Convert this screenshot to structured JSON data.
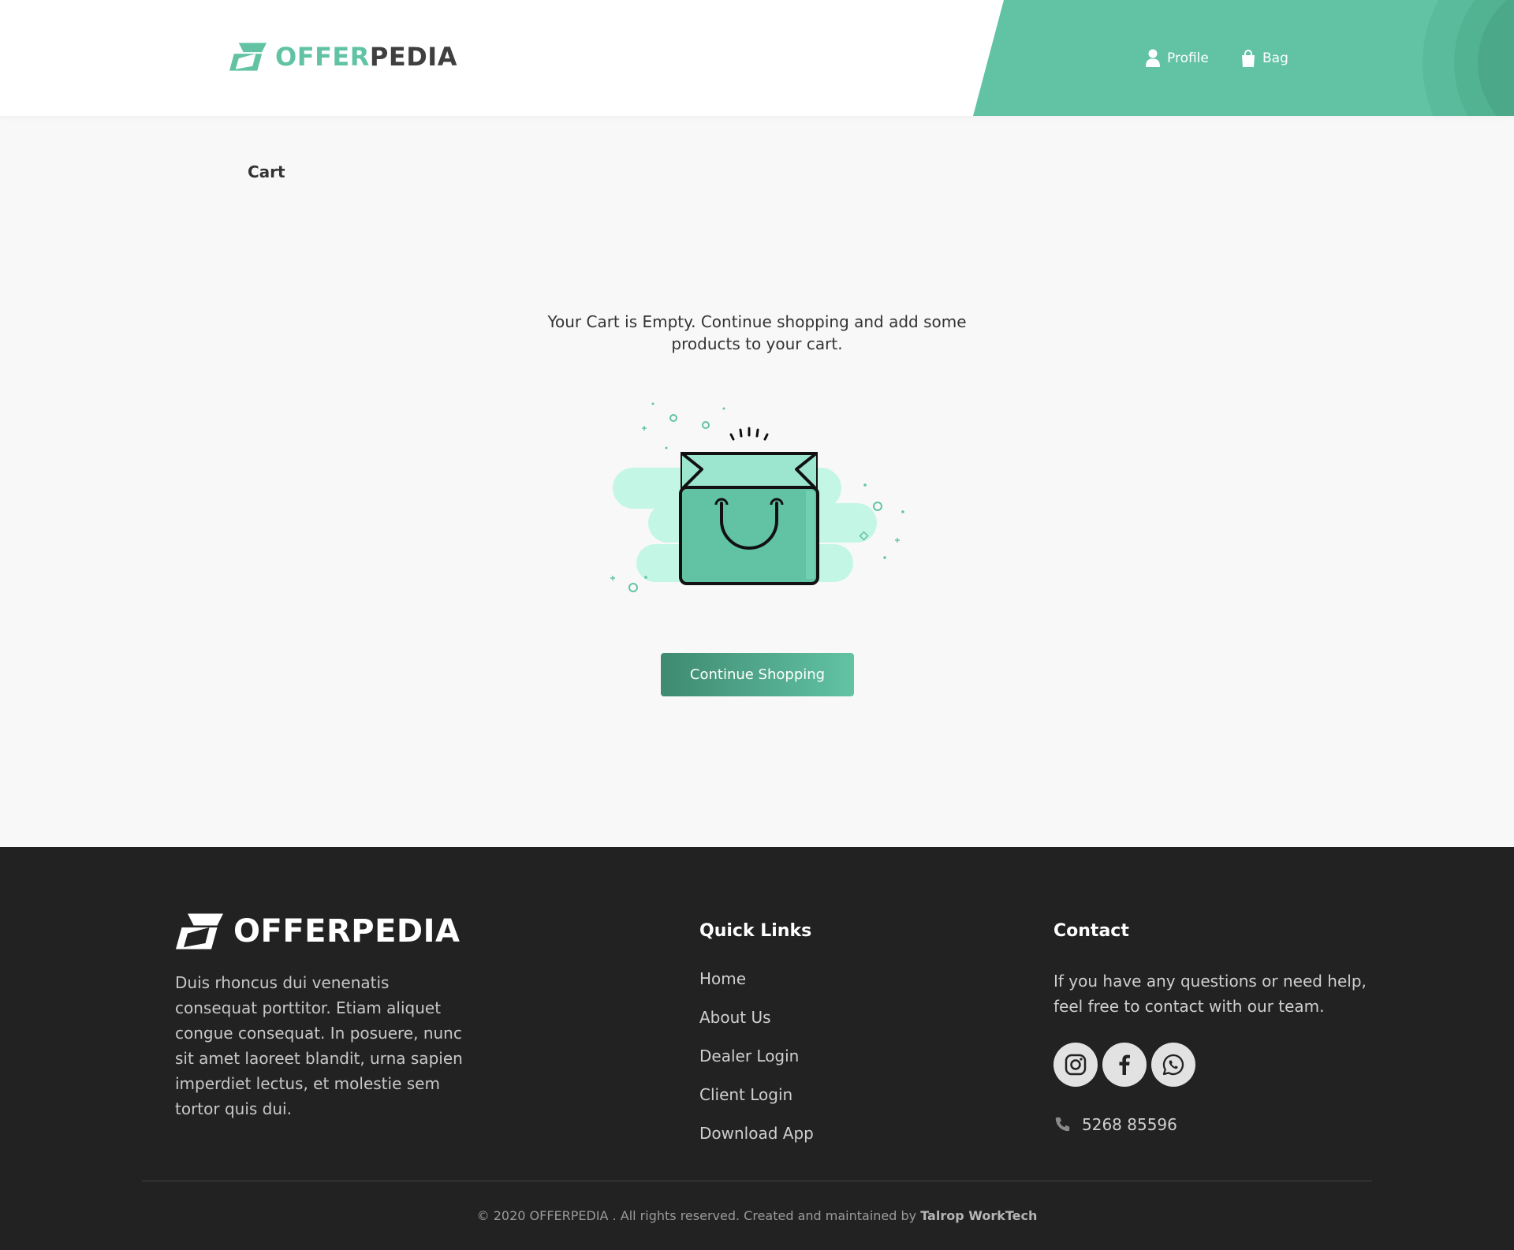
{
  "header": {
    "logo_part1": "OFFER",
    "logo_part2": "PEDIA",
    "nav": {
      "profile": "Profile",
      "bag": "Bag"
    }
  },
  "main": {
    "breadcrumb": "Cart",
    "empty_message": "Your Cart is Empty. Continue shopping and add some products to your cart.",
    "illustration_icon": "shopping-bag-smile-icon",
    "button_label": "Continue Shopping"
  },
  "footer": {
    "logo_text": "OFFERPEDIA",
    "about": "Duis rhoncus dui venenatis consequat porttitor. Etiam aliquet congue consequat. In posuere, nunc sit amet laoreet blandit, urna sapien imperdiet lectus, et molestie sem tortor quis dui.",
    "quick_links_title": "Quick Links",
    "links": [
      "Home",
      "About Us",
      "Dealer Login",
      "Client Login",
      "Download App"
    ],
    "contact_title": "Contact",
    "contact_text": "If you have any questions or need help, feel free to contact with our team.",
    "socials": [
      "instagram-icon",
      "facebook-icon",
      "whatsapp-icon"
    ],
    "phone": "5268 85596",
    "copyright_prefix": "© 2020 OFFERPEDIA . All rights reserved. Created and maintained by ",
    "copyright_company": "Talrop WorkTech"
  },
  "colors": {
    "accent": "#62c3a4",
    "accent_dark": "#3f8a71",
    "footer_bg": "#222222",
    "page_bg": "#f8f8f8"
  }
}
